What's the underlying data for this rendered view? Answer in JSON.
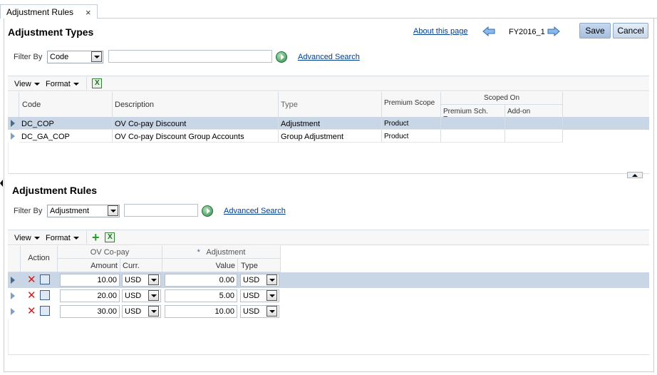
{
  "tab": {
    "title": "Adjustment Rules",
    "close": "×"
  },
  "header": {
    "title": "Adjustment Types",
    "about_link": "About this page",
    "record": "FY2016_1",
    "save": "Save",
    "cancel": "Cancel"
  },
  "types_filter": {
    "label": "Filter By",
    "selected": "Code",
    "value": "",
    "advanced": "Advanced Search"
  },
  "types_toolbar": {
    "view": "View",
    "format": "Format"
  },
  "types_table": {
    "columns": {
      "code": "Code",
      "description": "Description",
      "type": "Type",
      "premium_scope": "Premium Scope",
      "scoped_on": "Scoped On",
      "premium_sch_type": "Premium Sch. Type",
      "addon": "Add-on"
    },
    "rows": [
      {
        "code": "DC_COP",
        "description": "OV Co-pay Discount",
        "type": "Adjustment",
        "premium_scope": "Product",
        "premium_sch_type": "",
        "addon": ""
      },
      {
        "code": "DC_GA_COP",
        "description": "OV Co-pay Discount Group Accounts",
        "type": "Group Adjustment",
        "premium_scope": "Product",
        "premium_sch_type": "",
        "addon": ""
      }
    ]
  },
  "rules": {
    "title": "Adjustment Rules",
    "filter": {
      "label": "Filter By",
      "selected": "Adjustment",
      "value": "",
      "advanced": "Advanced Search"
    },
    "toolbar": {
      "view": "View",
      "format": "Format"
    },
    "columns": {
      "action": "Action",
      "group_copay": "OV Co-pay",
      "group_adjustment": "Adjustment",
      "required_mark": "*",
      "amount": "Amount",
      "curr": "Curr.",
      "value": "Value",
      "type": "Type"
    },
    "rows": [
      {
        "amount": "10.00",
        "curr": "USD",
        "value": "0.00",
        "type": "USD"
      },
      {
        "amount": "20.00",
        "curr": "USD",
        "value": "5.00",
        "type": "USD"
      },
      {
        "amount": "30.00",
        "curr": "USD",
        "value": "10.00",
        "type": "USD"
      }
    ]
  }
}
